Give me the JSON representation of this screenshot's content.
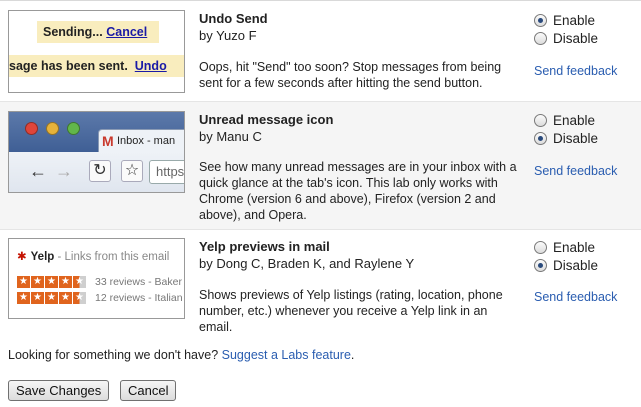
{
  "labs": [
    {
      "title": "Undo Send",
      "author": "by Yuzo F",
      "description": "Oops, hit \"Send\" too soon? Stop messages from being sent for a few seconds after hitting the send button.",
      "options": {
        "enable": "Enable",
        "disable": "Disable",
        "selected": "enable"
      },
      "feedback": "Send feedback",
      "thumbnail": {
        "sending_text": "Sending...",
        "cancel_link": "Cancel",
        "sent_text": "sage has been sent.",
        "undo_link": "Undo"
      }
    },
    {
      "title": "Unread message icon",
      "author": "by Manu C",
      "description": "See how many unread messages are in your inbox with a quick glance at the tab's icon. This lab only works with Chrome (version 6 and above), Firefox (version 2 and above), and Opera.",
      "options": {
        "enable": "Enable",
        "disable": "Disable",
        "selected": "disable"
      },
      "feedback": "Send feedback",
      "thumbnail": {
        "tab_label": "Inbox - man",
        "url_text": "https",
        "back_glyph": "←",
        "forward_glyph": "→",
        "reload_glyph": "↻",
        "star_glyph": "☆",
        "gmail_glyph": "M"
      }
    },
    {
      "title": "Yelp previews in mail",
      "author": "by Dong C, Braden K, and Raylene Y",
      "description": "Shows previews of Yelp listings (rating, location, phone number, etc.) whenever you receive a Yelp link in an email.",
      "options": {
        "enable": "Enable",
        "disable": "Disable",
        "selected": "disable"
      },
      "feedback": "Send feedback",
      "thumbnail": {
        "brand": "Yelp",
        "header_rest": " - Links from this email",
        "rows": [
          {
            "reviews": "33 reviews - Baker",
            "rating": 4.5
          },
          {
            "reviews": "12 reviews - Italian",
            "rating": 4.5
          }
        ]
      }
    }
  ],
  "footer": {
    "question": "Looking for something we don't have? ",
    "suggest_link": "Suggest a Labs feature",
    "suggest_suffix": ".",
    "save_button": "Save Changes",
    "cancel_button": "Cancel"
  },
  "colors": {
    "link": "#2a5db0",
    "yelp_red": "#c41200",
    "star_orange": "#e0641d",
    "highlight_yellow": "#f9edbe"
  }
}
